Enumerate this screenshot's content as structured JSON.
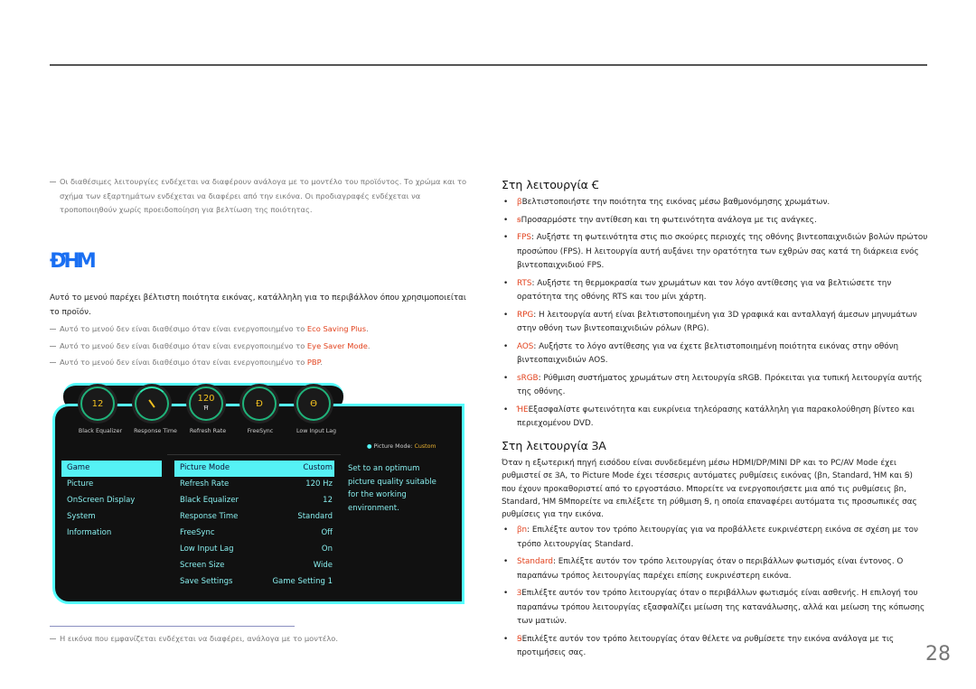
{
  "top_note": "Οι διαθέσιμες λειτουργίες ενδέχεται να διαφέρουν ανάλογα με το μοντέλο του προϊόντος. Το χρώμα και το σχήμα των εξαρτημάτων ενδέχεται να διαφέρει από την εικόνα. Οι προδιαγραφές ενδέχεται να τροποποιηθούν χωρίς προειδοποίηση για βελτίωση της ποιότητας.",
  "section_title": "ĐꞪM",
  "intro": "Αυτό το μενού παρέχει βέλτιστη ποιότητα εικόνας, κατάλληλη για το περιβάλλον όπου χρησιμοποιείται το προϊόν.",
  "notes": [
    {
      "text": "Αυτό το μενού δεν είναι διαθέσιμο όταν είναι ενεργοποιημένο το ",
      "hl": "Eco Saving Plus"
    },
    {
      "text": "Αυτό το μενού δεν είναι διαθέσιμο όταν είναι ενεργοποιημένο το ",
      "hl": "Eye Saver Mode"
    },
    {
      "text": "Αυτό το μενού δεν είναι διαθέσιμο όταν είναι ενεργοποιημένο το ",
      "hl": "PBP"
    }
  ],
  "osd": {
    "dials": [
      {
        "value": "12",
        "label": "Black Equalizer"
      },
      {
        "value": "",
        "label": "Response Time"
      },
      {
        "value": "120",
        "sub": "Ħ",
        "label": "Refresh Rate"
      },
      {
        "value": "Đ",
        "label": "FreeSync"
      },
      {
        "value": "Ө",
        "label": "Low Input Lag"
      }
    ],
    "status_label": "Picture Mode: ",
    "status_value": "Custom",
    "menu": [
      "Game",
      "Picture",
      "OnScreen Display",
      "System",
      "Information"
    ],
    "settings": [
      [
        "Picture Mode",
        "Custom"
      ],
      [
        "Refresh Rate",
        "120 Hz"
      ],
      [
        "Black Equalizer",
        "12"
      ],
      [
        "Response Time",
        "Standard"
      ],
      [
        "FreeSync",
        "Off"
      ],
      [
        "Low Input Lag",
        "On"
      ],
      [
        "Screen Size",
        "Wide"
      ],
      [
        "Save Settings",
        "Game Setting 1"
      ]
    ],
    "description": "Set to an optimum picture quality suitable for the working environment."
  },
  "caption": "Η εικόνα που εμφανίζεται ενδέχεται να διαφέρει, ανάλογα με το μοντέλο.",
  "pc_heading": "Στη λειτουργία Ꞓ",
  "pc_items": [
    {
      "hl": "ꞵ",
      "text": "Βελτιστοποιήστε την ποιότητα της εικόνας μέσω βαθμονόμησης χρωμάτων."
    },
    {
      "hl": "ꞩ",
      "text": "Προσαρμόστε την αντίθεση και τη φωτεινότητα ανάλογα με τις ανάγκες."
    },
    {
      "hl": "FPS",
      "text": ": Αυξήστε τη φωτεινότητα στις πιο σκούρες περιοχές της οθόνης βιντεοπαιχνιδιών βολών πρώτου προσώπου (FPS). Η λειτουργία αυτή αυξάνει την ορατότητα των εχθρών σας κατά τη διάρκεια ενός βιντεοπαιχνιδιού FPS."
    },
    {
      "hl": "RTS",
      "text": ": Αυξήστε τη θερμοκρασία των χρωμάτων και τον λόγο αντίθεσης για να βελτιώσετε την ορατότητα της οθόνης RTS και του μίνι χάρτη."
    },
    {
      "hl": "RPG",
      "text": ": Η λειτουργία αυτή είναι βελτιστοποιημένη για 3D γραφικά και ανταλλαγή άμεσων μηνυμάτων στην οθόνη των βιντεοπαιχνιδιών ρόλων (RPG)."
    },
    {
      "hl": "AOS",
      "text": ": Αυξήστε το λόγο αντίθεσης για να έχετε βελτιστοποιημένη ποιότητα εικόνας στην οθόνη βιντεοπαιχνιδιών AOS."
    },
    {
      "hl": "sRGB",
      "text": ": Ρύθμιση συστήματος χρωμάτων στη λειτουργία sRGB. Πρόκειται για τυπική λειτουργία αυτής της οθόνης."
    },
    {
      "hl": "ꞪE",
      "text": "Εξασφαλίστε φωτεινότητα και ευκρίνεια τηλεόρασης κατάλληλη για παρακολούθηση βίντεο και περιεχομένου DVD."
    }
  ],
  "av_heading": "Στη λειτουργία ꞫA",
  "av_intro": "Όταν η εξωτερική πηγή εισόδου είναι συνδεδεμένη μέσω HDMI/DP/MINI DP και το PC/AV Mode έχει ρυθμιστεί σε ꞫA, το Picture Mode έχει τέσσερις αυτόματες ρυθμίσεις εικόνας (ꞵn, Standard, ꞪM και Ꞩ) που έχουν προκαθοριστεί από το εργοστάσιο. Μπορείτε να ενεργοποιήσετε μια από τις ρυθμίσεις ꞵn, Standard, ꞪM ꞨΜπορείτε να επιλέξετε τη ρύθμιση Ꞩ, η οποία επαναφέρει αυτόματα τις προσωπικές σας ρυθμίσεις για την εικόνα.",
  "av_items": [
    {
      "hl": "ꞵn",
      "text": ": Επιλέξτε αυτον τον τρόπο λειτουργίας για να προβάλλετε ευκρινέστερη εικόνα σε σχέση με τον τρόπο λειτουργίας Standard."
    },
    {
      "hl": "Standard",
      "text": ": Επιλέξτε αυτόν τον τρόπο λειτουργίας όταν ο περιβάλλων φωτισμός είναι έντονος. Ο παραπάνω τρόπος λειτουργίας παρέχει επίσης ευκρινέστερη εικόνα."
    },
    {
      "hl": "Ɜ",
      "text": "Επιλέξτε αυτόν τον τρόπο λειτουργίας όταν ο περιβάλλων φωτισμός είναι ασθενής. Η επιλογή του παραπάνω τρόπου λειτουργίας εξασφαλίζει μείωση της κατανάλωσης, αλλά και μείωση της κόπωσης των ματιών."
    },
    {
      "hl": "Ꞩ",
      "text": "Επιλέξτε αυτόν τον τρόπο λειτουργίας όταν θέλετε να ρυθμίσετε την εικόνα ανάλογα με τις προτιμήσεις σας."
    }
  ],
  "page_number": "28"
}
